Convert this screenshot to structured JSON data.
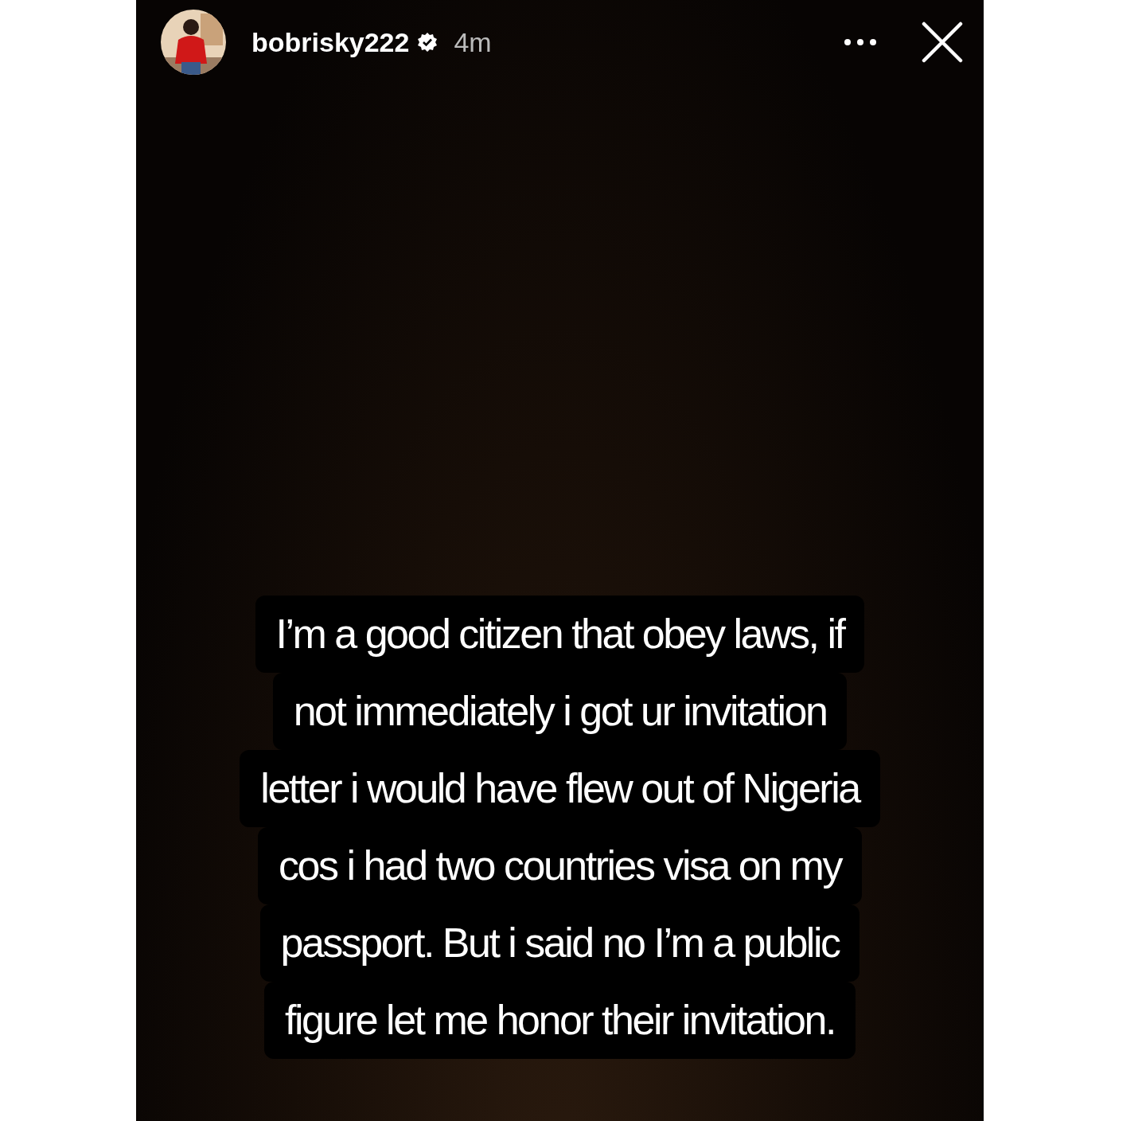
{
  "story": {
    "username": "bobrisky222",
    "verified": true,
    "time": "4m",
    "caption_blocks": [
      {
        "lines": [
          "I’m a good citizen that obey laws, if",
          "not immediately i got ur invitation",
          "letter i would have flew out of Nigeria"
        ]
      },
      {
        "lines": [
          "cos i had two countries visa on my",
          "passport. But i said no I’m a public",
          "figure let me honor their invitation."
        ]
      }
    ]
  }
}
